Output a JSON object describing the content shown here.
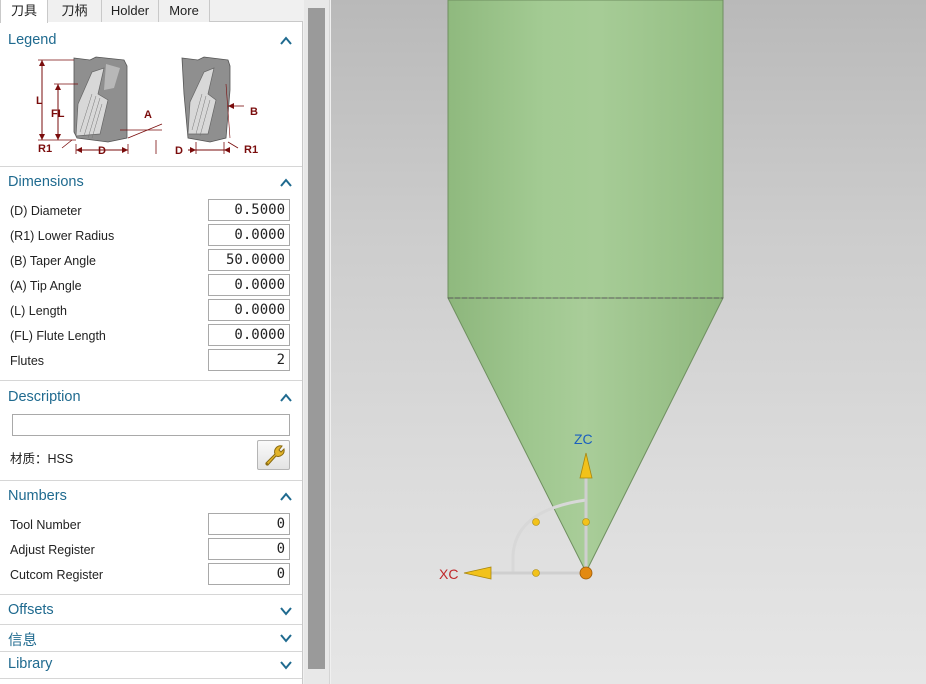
{
  "tabs": [
    {
      "label": "刀具"
    },
    {
      "label": "刀柄"
    },
    {
      "label": "Holder"
    },
    {
      "label": "More"
    }
  ],
  "legend": {
    "title": "Legend",
    "labels": {
      "L": "L",
      "FL": "FL",
      "A": "A",
      "B": "B",
      "D_left": "D",
      "D_right": "D",
      "R1_left": "R1",
      "R1_right": "R1"
    }
  },
  "dimensions": {
    "title": "Dimensions",
    "rows": [
      {
        "label": "(D) Diameter",
        "value": "0.5000"
      },
      {
        "label": "(R1) Lower Radius",
        "value": "0.0000"
      },
      {
        "label": "(B) Taper Angle",
        "value": "50.0000"
      },
      {
        "label": "(A) Tip Angle",
        "value": "0.0000"
      },
      {
        "label": "(L) Length",
        "value": "0.0000"
      },
      {
        "label": "(FL) Flute Length",
        "value": "0.0000"
      },
      {
        "label": "Flutes",
        "value": "2"
      }
    ]
  },
  "description": {
    "title": "Description",
    "value": "",
    "material": "材质：HSS",
    "material_icon": "wrench-icon"
  },
  "numbers": {
    "title": "Numbers",
    "rows": [
      {
        "label": "Tool Number",
        "value": "0"
      },
      {
        "label": "Adjust Register",
        "value": "0"
      },
      {
        "label": "Cutcom Register",
        "value": "0"
      }
    ]
  },
  "collapsed_sections": [
    {
      "title": "Offsets"
    },
    {
      "title": "信息"
    },
    {
      "title": "Library"
    }
  ],
  "viewport": {
    "axis_z": "ZC",
    "axis_x": "XC",
    "tool_color": "#9cc78b",
    "axis_z_color": "#1a5fbf",
    "axis_x_color": "#c0282b"
  }
}
